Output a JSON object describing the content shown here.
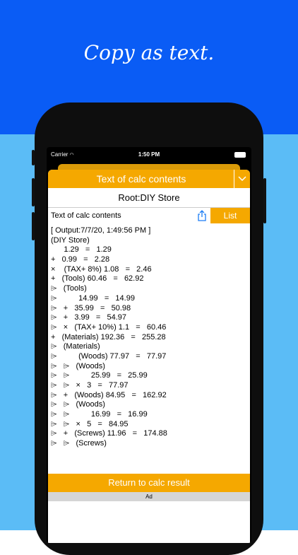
{
  "caption": "Copy as text.",
  "status": {
    "carrier": "Carrier",
    "time": "1:50 PM"
  },
  "nav": {
    "title": "Text of calc contents"
  },
  "root_title": "Root:DIY Store",
  "toolbar": {
    "label": "Text of calc contents",
    "list_label": "List"
  },
  "content_lines": [
    "[ Output:7/7/20, 1:49:56 PM ]",
    "(DIY Store)",
    "      1.29   =   1.29",
    "+   0.99   =   2.28",
    "×    (TAX+ 8%) 1.08   =   2.46",
    "+   (Tools) 60.46   =   62.92",
    "⌲   (Tools)",
    "⌲          14.99   =   14.99",
    "⌲   +   35.99   =   50.98",
    "⌲   +   3.99   =   54.97",
    "⌲   ×   (TAX+ 10%) 1.1   =   60.46",
    "+   (Materials) 192.36   =   255.28",
    "⌲   (Materials)",
    "⌲          (Woods) 77.97   =   77.97",
    "⌲   ⌲   (Woods)",
    "⌲   ⌲          25.99   =   25.99",
    "⌲   ⌲   ×   3   =   77.97",
    "⌲   +   (Woods) 84.95   =   162.92",
    "⌲   ⌲   (Woods)",
    "⌲   ⌲          16.99   =   16.99",
    "⌲   ⌲   ×   5   =   84.95",
    "⌲   +   (Screws) 11.96   =   174.88",
    "⌲   ⌲   (Screws)"
  ],
  "return_button": "Return to calc result",
  "ad_label": "Ad"
}
